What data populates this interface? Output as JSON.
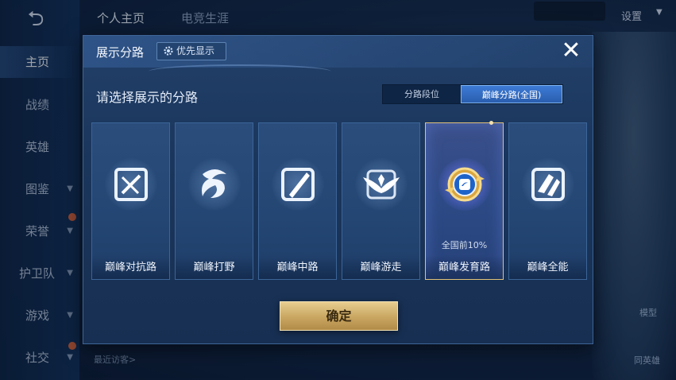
{
  "sidebar": {
    "items": [
      {
        "label": "主页"
      },
      {
        "label": "战绩"
      },
      {
        "label": "英雄"
      },
      {
        "label": "图鉴"
      },
      {
        "label": "荣誉"
      },
      {
        "label": "护卫队"
      },
      {
        "label": "游戏"
      },
      {
        "label": "社交"
      }
    ]
  },
  "topbar": {
    "tabs": [
      "个人主页",
      "电竞生涯"
    ],
    "settings_label": "设置"
  },
  "background": {
    "label_model": "模型",
    "label_hero": "同英雄"
  },
  "visitors_label": "最近访客>",
  "modal": {
    "title": "展示分路",
    "priority_label": "优先显示",
    "subtitle": "请选择展示的分路",
    "segments": [
      "分路段位",
      "巅峰分路(全国)"
    ],
    "cards": [
      {
        "label": "巅峰对抗路",
        "icon": "sword-icon"
      },
      {
        "label": "巅峰打野",
        "icon": "dragon-icon"
      },
      {
        "label": "巅峰中路",
        "icon": "slash-icon"
      },
      {
        "label": "巅峰游走",
        "icon": "wings-icon"
      },
      {
        "label": "巅峰发育路",
        "icon": "marksman-badge-icon",
        "rank": "全国前10%",
        "selected": true
      },
      {
        "label": "巅峰全能",
        "icon": "allround-icon"
      }
    ],
    "confirm_label": "确定"
  },
  "colors": {
    "accent_blue": "#3d7bd6",
    "gold": "#c9a661",
    "panel": "#1b365c"
  }
}
